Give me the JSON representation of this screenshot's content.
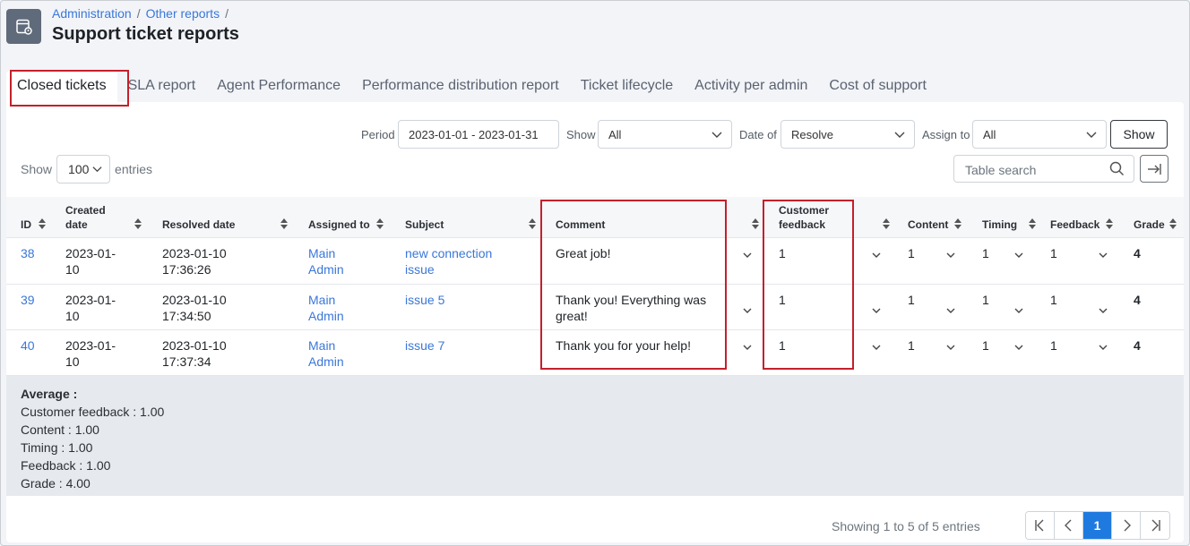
{
  "breadcrumb": [
    "Administration",
    "Other reports"
  ],
  "page_title": "Support ticket reports",
  "tabs": [
    "Closed tickets",
    "SLA report",
    "Agent Performance",
    "Performance distribution report",
    "Ticket lifecycle",
    "Activity per admin",
    "Cost of support"
  ],
  "filters": {
    "period_label": "Period",
    "period_value": "2023-01-01 - 2023-01-31",
    "show_label": "Show",
    "show_value": "All",
    "date_of_label": "Date of",
    "date_of_value": "Resolve",
    "assign_to_label": "Assign to",
    "assign_to_value": "All",
    "show_button": "Show"
  },
  "entries": {
    "prefix": "Show",
    "value": "100",
    "suffix": "entries"
  },
  "search": {
    "placeholder": "Table search"
  },
  "columns": {
    "id": "ID",
    "created": [
      "Created",
      "date"
    ],
    "resolved": "Resolved date",
    "assigned": "Assigned to",
    "subject": "Subject",
    "comment": "Comment",
    "feedback_customer": [
      "Customer",
      "feedback"
    ],
    "content": "Content",
    "timing": "Timing",
    "feedback": "Feedback",
    "grade": "Grade"
  },
  "rows": [
    {
      "id": "38",
      "created": [
        "2023-01-",
        "10"
      ],
      "resolved": [
        "2023-01-10",
        "17:36:26"
      ],
      "assigned": [
        "Main",
        "Admin"
      ],
      "subject": [
        "new connection",
        "issue"
      ],
      "comment": [
        "Great job!"
      ],
      "customer_feedback": "1",
      "content": "1",
      "timing": "1",
      "feedback": "1",
      "grade": "4"
    },
    {
      "id": "39",
      "created": [
        "2023-01-",
        "10"
      ],
      "resolved": [
        "2023-01-10",
        "17:34:50"
      ],
      "assigned": [
        "Main",
        "Admin"
      ],
      "subject": [
        "issue 5"
      ],
      "comment": [
        "Thank you! Everything was",
        "great!"
      ],
      "customer_feedback": "1",
      "content": "1",
      "timing": "1",
      "feedback": "1",
      "grade": "4"
    },
    {
      "id": "40",
      "created": [
        "2023-01-",
        "10"
      ],
      "resolved": [
        "2023-01-10",
        "17:37:34"
      ],
      "assigned": [
        "Main",
        "Admin"
      ],
      "subject": [
        "issue 7"
      ],
      "comment": [
        "Thank you for your help!"
      ],
      "customer_feedback": "1",
      "content": "1",
      "timing": "1",
      "feedback": "1",
      "grade": "4"
    }
  ],
  "averages": {
    "heading": "Average :",
    "lines": [
      "Customer feedback : 1.00",
      "Content : 1.00",
      "Timing : 1.00",
      "Feedback : 1.00",
      "Grade : 4.00"
    ]
  },
  "footer": {
    "showing": "Showing 1 to 5 of 5 entries",
    "current_page": "1"
  },
  "colors": {
    "link": "#3a77d8",
    "highlight": "#c4202b",
    "page_active": "#1f7ae0"
  }
}
